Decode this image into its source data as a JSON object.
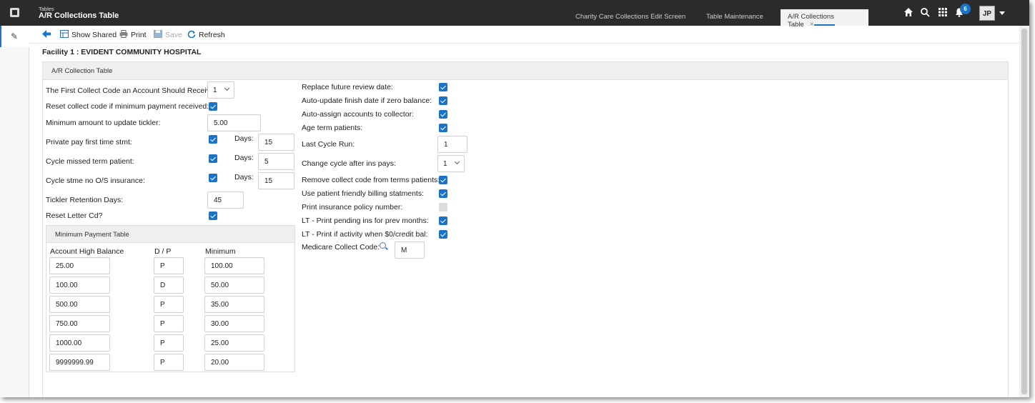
{
  "app": {
    "subtitle": "Tables",
    "title": "A/R Collections Table"
  },
  "tabs": [
    {
      "label": "Charity Care Collections Edit Screen"
    },
    {
      "label": "Table Maintenance"
    },
    {
      "label": "A/R Collections Table",
      "close": "×"
    }
  ],
  "header": {
    "notification_count": "6",
    "avatar_initials": "JP"
  },
  "toolbar": {
    "show_shared": "Show Shared",
    "print": "Print",
    "save": "Save",
    "refresh": "Refresh"
  },
  "facility": "Facility 1 : EVIDENT COMMUNITY HOSPITAL",
  "panel_title": "A/R Collection Table",
  "left_fields": {
    "first_collect_code_label": "The First Collect Code an Account Should Receive:",
    "first_collect_code_value": "1",
    "reset_collect_label": "Reset collect code if minimum payment received:",
    "min_amount_label": "Minimum amount to update tickler:",
    "min_amount_value": "5.00",
    "private_pay_label": "Private pay first time stmt:",
    "private_pay_days": "15",
    "cycle_missed_label": "Cycle missed term patient:",
    "cycle_missed_days": "5",
    "cycle_stme_label": "Cycle stme no O/S insurance:",
    "cycle_stme_days": "15",
    "days_label": "Days:",
    "tickler_label": "Tickler Retention Days:",
    "tickler_value": "45",
    "reset_letter_label": "Reset Letter Cd?"
  },
  "min_payment_table": {
    "title": "Minimum Payment Table",
    "headers": [
      "Account High Balance",
      "D / P",
      "Minimum"
    ],
    "rows": [
      [
        "25.00",
        "P",
        "100.00"
      ],
      [
        "100.00",
        "D",
        "50.00"
      ],
      [
        "500.00",
        "P",
        "35.00"
      ],
      [
        "750.00",
        "P",
        "30.00"
      ],
      [
        "1000.00",
        "P",
        "25.00"
      ],
      [
        "9999999.99",
        "P",
        "20.00"
      ]
    ]
  },
  "right_fields": {
    "replace_future_label": "Replace future review date:",
    "auto_update_label": "Auto-update finish date if zero balance:",
    "auto_assign_label": "Auto-assign accounts to collector:",
    "age_term_label": "Age term patients:",
    "last_cycle_label": "Last Cycle Run:",
    "last_cycle_value": "1",
    "change_cycle_label": "Change cycle after ins pays:",
    "change_cycle_value": "1",
    "remove_collect_label": "Remove collect code from terms patients:",
    "use_friendly_label": "Use patient friendly billing statments:",
    "print_policy_label": "Print insurance policy number:",
    "lt_pending_label": "LT - Print pending ins for prev months:",
    "lt_activity_label": "LT - Print if activity when $0/credit bal:",
    "medicare_label": "Medicare Collect Code:",
    "medicare_value": "M"
  }
}
